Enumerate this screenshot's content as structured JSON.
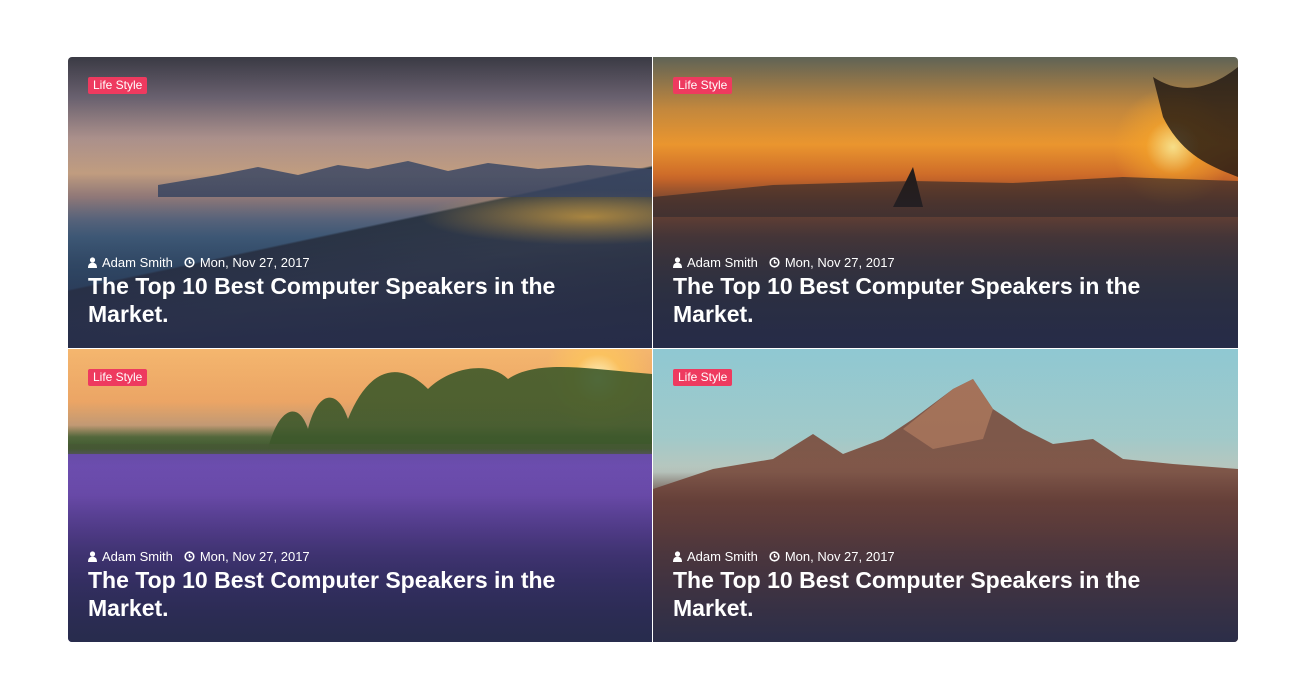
{
  "colors": {
    "badge": "#ee3a5f",
    "overlay": "#262c4a",
    "text": "#ffffff"
  },
  "posts": [
    {
      "category": "Life Style",
      "author": "Adam Smith",
      "date": "Mon, Nov 27, 2017",
      "title": "The Top 10 Best Computer Speakers in the Market."
    },
    {
      "category": "Life Style",
      "author": "Adam Smith",
      "date": "Mon, Nov 27, 2017",
      "title": "The Top 10 Best Computer Speakers in the Market."
    },
    {
      "category": "Life Style",
      "author": "Adam Smith",
      "date": "Mon, Nov 27, 2017",
      "title": "The Top 10 Best Computer Speakers in the Market."
    },
    {
      "category": "Life Style",
      "author": "Adam Smith",
      "date": "Mon, Nov 27, 2017",
      "title": "The Top 10 Best Computer Speakers in the Market."
    }
  ]
}
